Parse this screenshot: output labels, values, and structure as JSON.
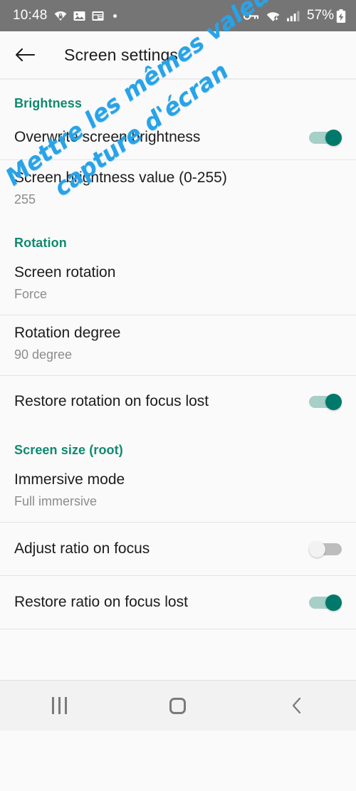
{
  "status_bar": {
    "clock": "10:48",
    "battery_text": "57%",
    "left_icons": [
      "wifi-secure-icon",
      "image-icon",
      "news-card-icon",
      "dot-indicator"
    ],
    "right_icons": [
      "vpn-key-icon",
      "wifi-icon",
      "signal-bars-icon",
      "battery-charging-icon"
    ],
    "background": "#757575"
  },
  "app_bar": {
    "back_label": "back-arrow",
    "title": "Screen settings"
  },
  "accent_color": "#0f8a6f",
  "annotation": {
    "line1": "Mettre les mêmes valeurs que sur la",
    "line2": "capture d'écran",
    "color": "#29a3e8"
  },
  "sections": [
    {
      "header": "Brightness",
      "rows": [
        {
          "title": "Overwrite screen brightness",
          "subtitle": "",
          "control": "switch",
          "state": "on"
        },
        {
          "title": "Screen brightness value (0-255)",
          "subtitle": "255",
          "control": "none",
          "state": ""
        }
      ]
    },
    {
      "header": "Rotation",
      "rows": [
        {
          "title": "Screen rotation",
          "subtitle": "Force",
          "control": "none",
          "state": ""
        },
        {
          "title": "Rotation degree",
          "subtitle": "90 degree",
          "control": "none",
          "state": ""
        },
        {
          "title": "Restore rotation on focus lost",
          "subtitle": "",
          "control": "switch",
          "state": "on"
        }
      ]
    },
    {
      "header": "Screen size (root)",
      "rows": [
        {
          "title": "Immersive mode",
          "subtitle": "Full immersive",
          "control": "none",
          "state": ""
        },
        {
          "title": "Adjust ratio on focus",
          "subtitle": "",
          "control": "switch",
          "state": "off"
        },
        {
          "title": "Restore ratio on focus lost",
          "subtitle": "",
          "control": "switch",
          "state": "on"
        }
      ]
    }
  ],
  "nav_bar": {
    "recents": "recents-icon",
    "home": "home-icon",
    "back": "back-icon"
  }
}
